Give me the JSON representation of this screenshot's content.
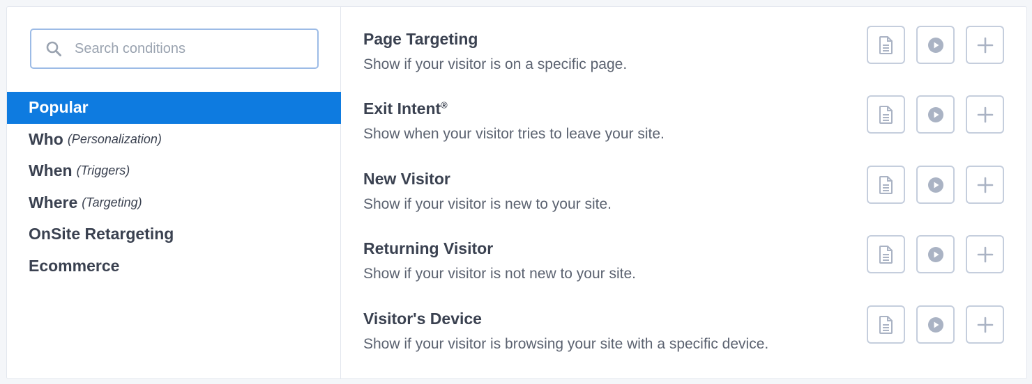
{
  "search": {
    "placeholder": "Search conditions",
    "value": ""
  },
  "categories": [
    {
      "label": "Popular",
      "sub": "",
      "active": true
    },
    {
      "label": "Who",
      "sub": "(Personalization)"
    },
    {
      "label": "When",
      "sub": "(Triggers)"
    },
    {
      "label": "Where",
      "sub": "(Targeting)"
    },
    {
      "label": "OnSite Retargeting",
      "sub": ""
    },
    {
      "label": "Ecommerce",
      "sub": ""
    }
  ],
  "conditions": [
    {
      "title": "Page Targeting",
      "mark": "",
      "description": "Show if your visitor is on a specific page."
    },
    {
      "title": "Exit Intent",
      "mark": "®",
      "description": "Show when your visitor tries to leave your site."
    },
    {
      "title": "New Visitor",
      "mark": "",
      "description": "Show if your visitor is new to your site."
    },
    {
      "title": "Returning Visitor",
      "mark": "",
      "description": "Show if your visitor is not new to your site."
    },
    {
      "title": "Visitor's Device",
      "mark": "",
      "description": "Show if your visitor is browsing your site with a specific device."
    }
  ],
  "icons": {
    "search": "search-icon",
    "doc": "document-icon",
    "play": "play-icon",
    "add": "plus-icon"
  },
  "colors": {
    "accent": "#0e7be0",
    "icon": "#aab3c4",
    "border": "#c5cedd"
  }
}
